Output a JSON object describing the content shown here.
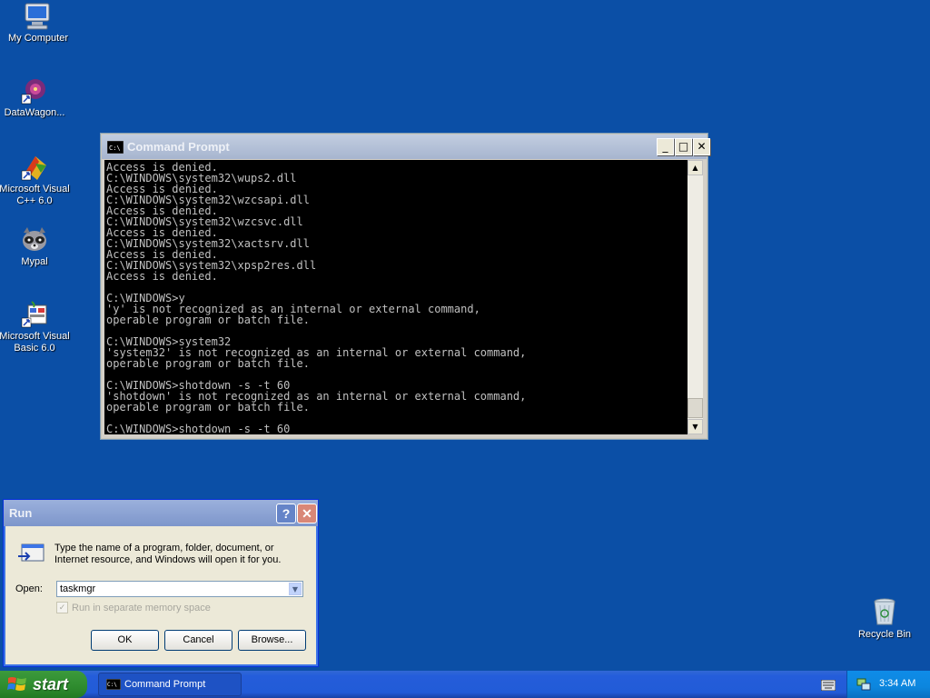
{
  "desktop": {
    "icons": [
      {
        "label": "My Computer"
      },
      {
        "label": "DataWagon..."
      },
      {
        "label": "Microsoft Visual C++ 6.0"
      },
      {
        "label": "Mypal"
      },
      {
        "label": "Microsoft Visual Basic 6.0"
      },
      {
        "label": "Recycle Bin"
      }
    ]
  },
  "cmd_window": {
    "title": "Command Prompt",
    "output": "Access is denied.\nC:\\WINDOWS\\system32\\wups2.dll\nAccess is denied.\nC:\\WINDOWS\\system32\\wzcsapi.dll\nAccess is denied.\nC:\\WINDOWS\\system32\\wzcsvc.dll\nAccess is denied.\nC:\\WINDOWS\\system32\\xactsrv.dll\nAccess is denied.\nC:\\WINDOWS\\system32\\xpsp2res.dll\nAccess is denied.\n\nC:\\WINDOWS>y\n'y' is not recognized as an internal or external command,\noperable program or batch file.\n\nC:\\WINDOWS>system32\n'system32' is not recognized as an internal or external command,\noperable program or batch file.\n\nC:\\WINDOWS>shotdown -s -t 60\n'shotdown' is not recognized as an internal or external command,\noperable program or batch file.\n\nC:\\WINDOWS>shotdown -s -t 60",
    "minimize": "_",
    "maximize": "□",
    "close": "✕"
  },
  "run_dialog": {
    "title": "Run",
    "help": "?",
    "close": "✕",
    "description": "Type the name of a program, folder, document, or Internet resource, and Windows will open it for you.",
    "open_label": "Open:",
    "open_value": "taskmgr",
    "checkbox_label": "Run in separate memory space",
    "checkbox_checked": true,
    "ok_label": "OK",
    "cancel_label": "Cancel",
    "browse_label": "Browse..."
  },
  "taskbar": {
    "start_label": "start",
    "task_label": "Command Prompt",
    "clock": "3:34 AM"
  },
  "colors": {
    "desktop": "#0b4fa6",
    "taskbar": "#245dda",
    "start": "#2e8b2e",
    "tray": "#0c86de"
  }
}
